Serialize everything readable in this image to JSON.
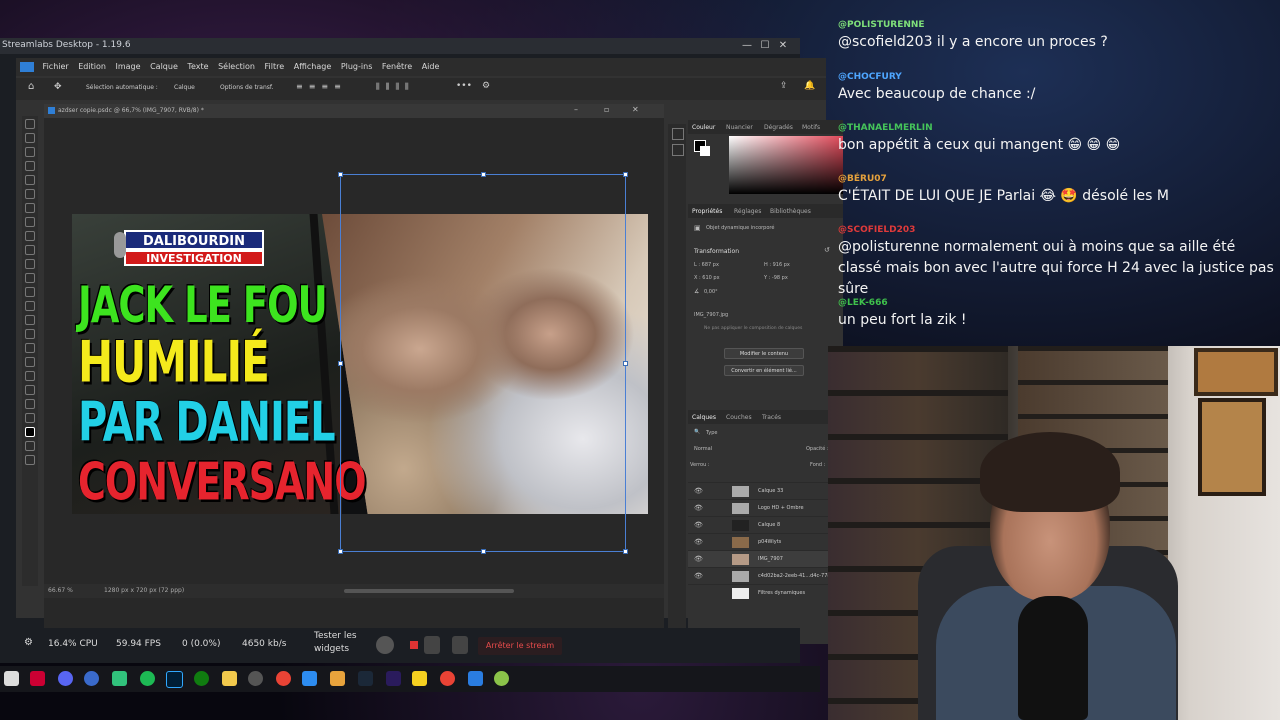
{
  "streamlabs": {
    "title": "Streamlabs Desktop - 1.19.6",
    "win_min": "—",
    "win_max": "☐",
    "win_close": "✕",
    "status": {
      "cpu": "16.4% CPU",
      "fps": "59.94 FPS",
      "dropped": "0 (0.0%)",
      "bitrate": "4650 kb/s",
      "test_widgets": "Tester les widgets",
      "stop_stream": "Arrêter le stream"
    }
  },
  "photoshop": {
    "menu": [
      "Fichier",
      "Edition",
      "Image",
      "Calque",
      "Texte",
      "Sélection",
      "Filtre",
      "Affichage",
      "Plug-ins",
      "Fenêtre",
      "Aide"
    ],
    "options": {
      "auto_select": "Sélection automatique :",
      "layer_select": "Calque",
      "transform": "Options de transf."
    },
    "document": {
      "tab": "azdser copie.psdc @ 66,7% (IMG_7907, RVB/8) *",
      "zoom": "66.67 %",
      "size": "1280 px x 720 px (72 ppp)"
    },
    "thumbnail": {
      "logo_top": "DALIBOURDIN",
      "logo_bottom": "INVESTIGATION",
      "line1": "JACK LE FOU",
      "line2": "HUMILIÉ",
      "line3": "PAR DANIEL",
      "line4": "CONVERSANO",
      "line1_color": "#3de41f",
      "line2_color": "#f4ea1c",
      "line3_color": "#22d0e6",
      "line4_color": "#e6242e"
    },
    "color_tabs": [
      "Couleur",
      "Nuancier",
      "Dégradés",
      "Motifs"
    ],
    "props_tabs": [
      "Propriétés",
      "Réglages",
      "Bibliothèques"
    ],
    "props": {
      "object": "Objet dynamique incorporé",
      "transform_label": "Transformation",
      "l": "L : 687 px",
      "h": "H : 916 px",
      "x": "X : 610 px",
      "y": "Y : -98 px",
      "angle": "0,00°",
      "file": "IMG_7907.jpg",
      "note": "Ne pas appliquer le composition de calques",
      "edit_btn": "Modifier le contenu",
      "convert_btn": "Convertir en élément lié..."
    },
    "layers_tabs": [
      "Calques",
      "Couches",
      "Tracés"
    ],
    "layers": {
      "kind": "Type",
      "mode": "Normal",
      "opacity": "Opacité :",
      "lock": "Verrou :",
      "fill": "Fond :",
      "items": [
        "Calque 33",
        "Logo HD + Ombre",
        "Calque 8",
        "p04Wiyts",
        "IMG_7907",
        "c4d02ba2-2eeb-41...d4c-778dd",
        "Filtres dynamiques"
      ]
    }
  },
  "chat": [
    {
      "user": "@POLISTURENNE",
      "color": "#7fe07a",
      "text": "@scofield203 il y a encore un proces ?"
    },
    {
      "user": "@CHOCFURY",
      "color": "#4ea6ff",
      "text": "Avec beaucoup de chance :/"
    },
    {
      "user": "@THANAELMERLIN",
      "color": "#45c45a",
      "text": "bon appétit à ceux qui mangent 😁 😁 😁"
    },
    {
      "user": "@BÉRU07",
      "color": "#e6a23c",
      "text": "C'ÉTAIT DE LUI QUE JE Parlai 😂 🤩 désolé les M"
    },
    {
      "user": "@SCOFIELD203",
      "color": "#e03a3a",
      "text": "@polisturenne normalement oui à moins que sa aille été classé mais bon avec l'autre qui force H 24 avec la justice pas sûre"
    },
    {
      "user": "@LEK-666",
      "color": "#3fc24c",
      "text": "un peu fort la zik !"
    }
  ]
}
